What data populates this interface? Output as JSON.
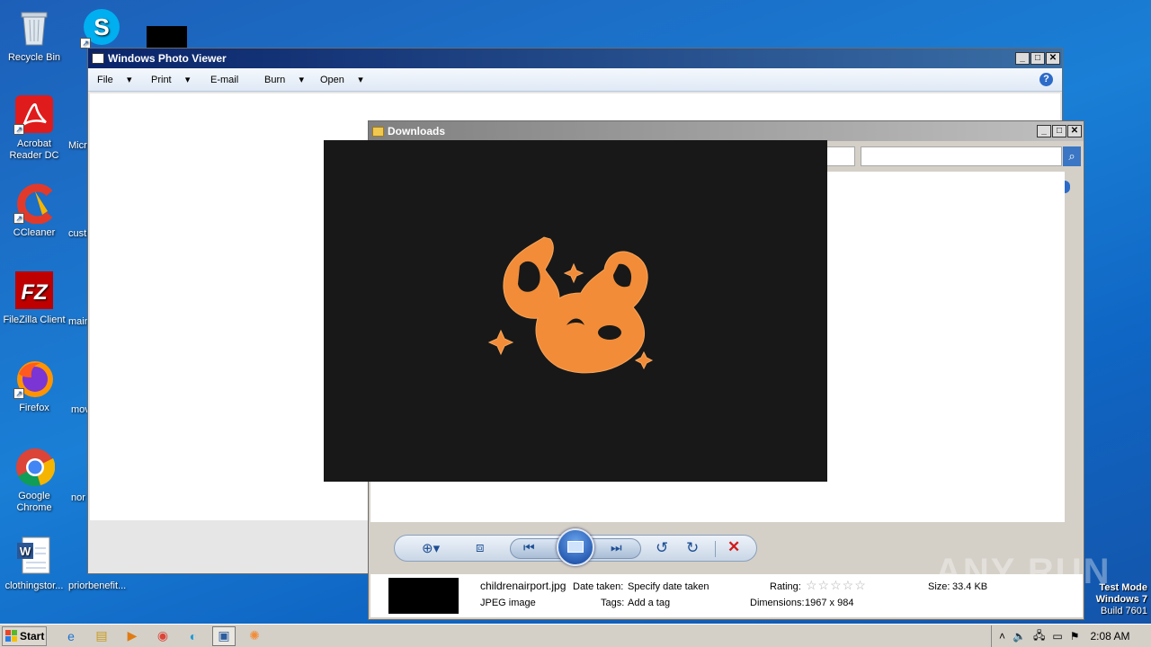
{
  "desktop": {
    "icons": [
      {
        "label": "Recycle Bin",
        "glyph": "🗑"
      },
      {
        "label": "Skype",
        "glyph": "S"
      },
      {
        "label": "Acrobat Reader DC",
        "glyph": "A"
      },
      {
        "label": "CCleaner",
        "glyph": "C"
      },
      {
        "label": "FileZilla Client",
        "glyph": "FZ"
      },
      {
        "label": "Firefox",
        "glyph": "🦊"
      },
      {
        "label": "Google Chrome",
        "glyph": "◉"
      },
      {
        "label": "clothingstor...",
        "glyph": "W"
      }
    ],
    "partial_labels": [
      "Micr",
      "cust",
      "main",
      "mov",
      "nor",
      "priorbenefit..."
    ]
  },
  "photo_viewer": {
    "title": "Windows Photo Viewer",
    "menu": [
      "File",
      "Print",
      "E-mail",
      "Burn",
      "Open"
    ],
    "help": "?"
  },
  "downloads": {
    "title": "Downloads",
    "file": {
      "name": "childrenairport.jpg",
      "type": "JPEG image",
      "date_label": "Date taken:",
      "date_value": "Specify date taken",
      "tags_label": "Tags:",
      "tags_value": "Add a tag",
      "rating_label": "Rating:",
      "rating_value": 0,
      "dims_label": "Dimensions:",
      "dims_value": "1967 x 984",
      "size_label": "Size:",
      "size_value": "33.4 KB"
    }
  },
  "watermark": {
    "text": "ANY RUN",
    "line1": "Test Mode",
    "line2": "Windows 7",
    "line3": "Build 7601"
  },
  "taskbar": {
    "start": "Start",
    "time": "2:08 AM"
  },
  "colors": {
    "accent": "#f28c38",
    "image_bg": "#181818",
    "titlebar_active": "#0a246a",
    "titlebar_inactive": "#808080"
  }
}
